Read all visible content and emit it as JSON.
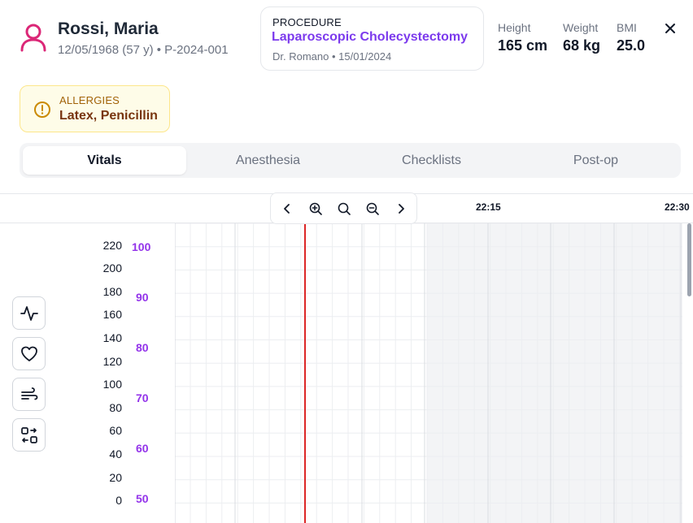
{
  "patient": {
    "name": "Rossi, Maria",
    "meta": "12/05/1968 (57 y) • P-2024-001",
    "avatar_icon": "user-icon"
  },
  "procedure": {
    "label": "PROCEDURE",
    "name": "Laparoscopic Cholecystectomy",
    "meta": "Dr. Romano • 15/01/2024"
  },
  "metrics": [
    {
      "label": "Height",
      "value": "165 cm"
    },
    {
      "label": "Weight",
      "value": "68 kg"
    },
    {
      "label": "BMI",
      "value": "25.0"
    }
  ],
  "allergies": {
    "label": "ALLERGIES",
    "value": "Latex, Penicillin",
    "icon": "alert-circle-icon"
  },
  "tabs": [
    {
      "label": "Vitals",
      "active": true
    },
    {
      "label": "Anesthesia",
      "active": false
    },
    {
      "label": "Checklists",
      "active": false
    },
    {
      "label": "Post-op",
      "active": false
    }
  ],
  "timeline": {
    "time_labels": [
      "22:15",
      "22:30"
    ]
  },
  "zoom_controls": [
    "chevron-left-icon",
    "zoom-in-icon",
    "zoom-reset-icon",
    "zoom-out-icon",
    "chevron-right-icon"
  ],
  "side_buttons": [
    "activity-icon",
    "heart-icon",
    "wind-icon",
    "device-swap-icon"
  ],
  "y_axis_left": [
    "220",
    "200",
    "180",
    "160",
    "140",
    "120",
    "100",
    "80",
    "60",
    "40",
    "20",
    "0"
  ],
  "y_axis_right": [
    "100",
    "90",
    "80",
    "70",
    "60",
    "50"
  ],
  "colors": {
    "accent": "#7c3aed",
    "avatar": "#db2777",
    "right_axis": "#9333ea",
    "now_line": "#dc2626",
    "allergy_bg": "#fefce8"
  }
}
